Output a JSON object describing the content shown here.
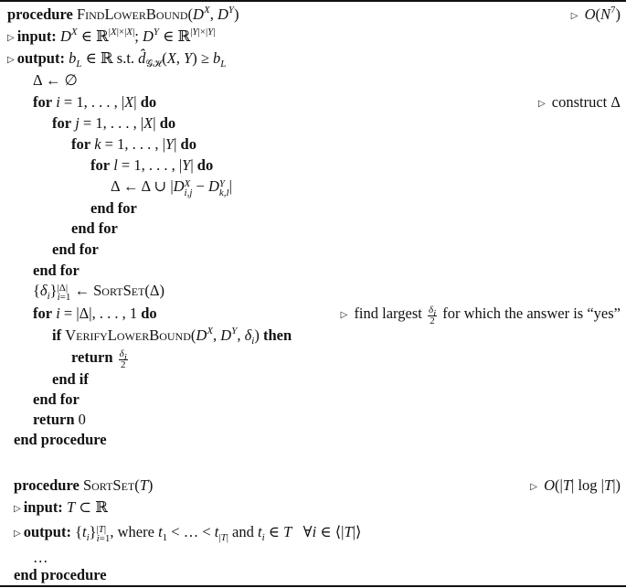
{
  "algorithm": {
    "find_lower_bound": {
      "header_keyword": "procedure",
      "name": "FindLowerBound",
      "args": "(D^X, D^Y)",
      "complexity": "O(N^7)",
      "input_label": "input:",
      "input_text": "D^X ∈ ℝ^{|X|×|X|}; D^Y ∈ ℝ^{|Y|×|Y|}",
      "output_label": "output:",
      "output_text": "b_L ∈ ℝ s.t. d̂_GH(X, Y) ≥ b_L",
      "lines": [
        {
          "indent": 1,
          "text": "Δ ← ∅"
        },
        {
          "indent": 1,
          "text": "for i = 1, . . . , |X| do",
          "comment": "construct Δ"
        },
        {
          "indent": 2,
          "text": "for j = 1, . . . , |X| do"
        },
        {
          "indent": 3,
          "text": "for k = 1, . . . , |Y| do"
        },
        {
          "indent": 4,
          "text": "for l = 1, . . . , |Y| do"
        },
        {
          "indent": 5,
          "text": "Δ ← Δ ∪ |D^X_{i,j} − D^Y_{k,l}|"
        },
        {
          "indent": 4,
          "text": "end for"
        },
        {
          "indent": 3,
          "text": "end for"
        },
        {
          "indent": 2,
          "text": "end for"
        },
        {
          "indent": 1,
          "text": "end for"
        },
        {
          "indent": 1,
          "text": "{δ_i}_{i=1}^{|Δ|} ← SortSet(Δ)"
        },
        {
          "indent": 1,
          "text": "for i = |Δ|, . . . , 1 do",
          "comment": "find largest δ_i/2 for which the answer is “yes”"
        },
        {
          "indent": 2,
          "text": "if VerifyLowerBound(D^X, D^Y, δ_i) then"
        },
        {
          "indent": 3,
          "text": "return δ_i/2"
        },
        {
          "indent": 2,
          "text": "end if"
        },
        {
          "indent": 1,
          "text": "end for"
        },
        {
          "indent": 1,
          "text": "return 0"
        },
        {
          "indent": 0,
          "text": "end procedure"
        }
      ]
    },
    "sort_set": {
      "header_keyword": "procedure",
      "name": "SortSet",
      "args": "(T)",
      "complexity": "O(|T| log |T|)",
      "input_label": "input:",
      "input_text": "T ⊂ ℝ",
      "output_label": "output:",
      "output_text": "{t_i}_{i=1}^{|T|}, where t_1 < . . . < t_|T| and t_i ∈ T  ∀i ∈ ⟨|T|⟩",
      "body_ellipsis": "…",
      "end": "end procedure"
    }
  },
  "labels": {
    "procedure": "procedure",
    "input": "input:",
    "output": "output:",
    "for": "for",
    "do": "do",
    "end_for": "end for",
    "end_if": "end if",
    "if": "if",
    "then": "then",
    "return": "return",
    "end_procedure": "end procedure",
    "st": "s.t.",
    "construct": "construct Δ",
    "find_largest": "find largest",
    "for_which": "for which the answer is “yes”",
    "where": "where",
    "and": "and",
    "find_name": "FindLowerBound",
    "verify_name": "VerifyLowerBound",
    "sort_name": "SortSet",
    "ellipsis": "…",
    "zero": "0"
  }
}
